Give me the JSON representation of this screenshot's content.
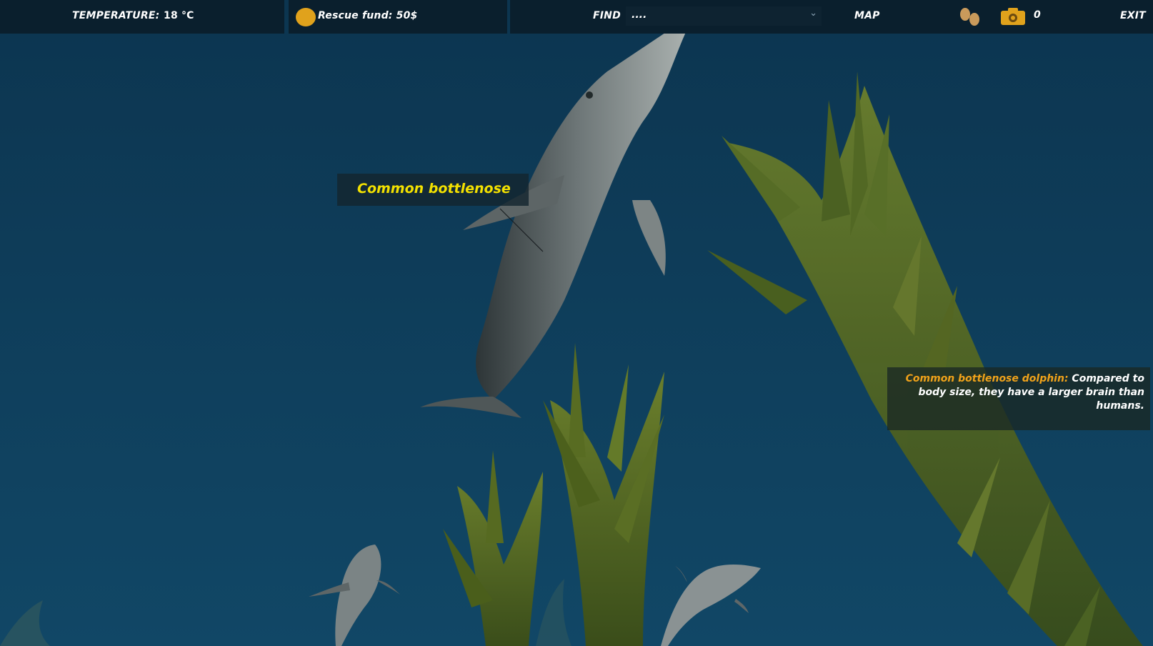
{
  "hud": {
    "temperature_label": "TEMPERATURE:",
    "temperature_value": "18 °C",
    "fund_text": "Rescue fund: 50$",
    "find_label": "FIND",
    "find_value": "....",
    "map_label": "MAP",
    "camera_count": "0",
    "exit_label": "EXIT"
  },
  "scene": {
    "species_label": "Common bottlenose",
    "fact_species": "Common bottlenose dolphin:",
    "fact_text": " Compared to body size, they have a larger brain than humans."
  },
  "icons": {
    "coin": "coin-icon",
    "footprints": "footprints-icon",
    "camera": "camera-icon",
    "dropdown": "chevron-down-icon"
  },
  "colors": {
    "water": "#0f3d5a",
    "hud_bg": "#0a1f2d",
    "label_yellow": "#f3e100",
    "fact_orange": "#f0a21a",
    "coin_gold": "#e0a21c",
    "seaweed": "#4f6b1f"
  }
}
